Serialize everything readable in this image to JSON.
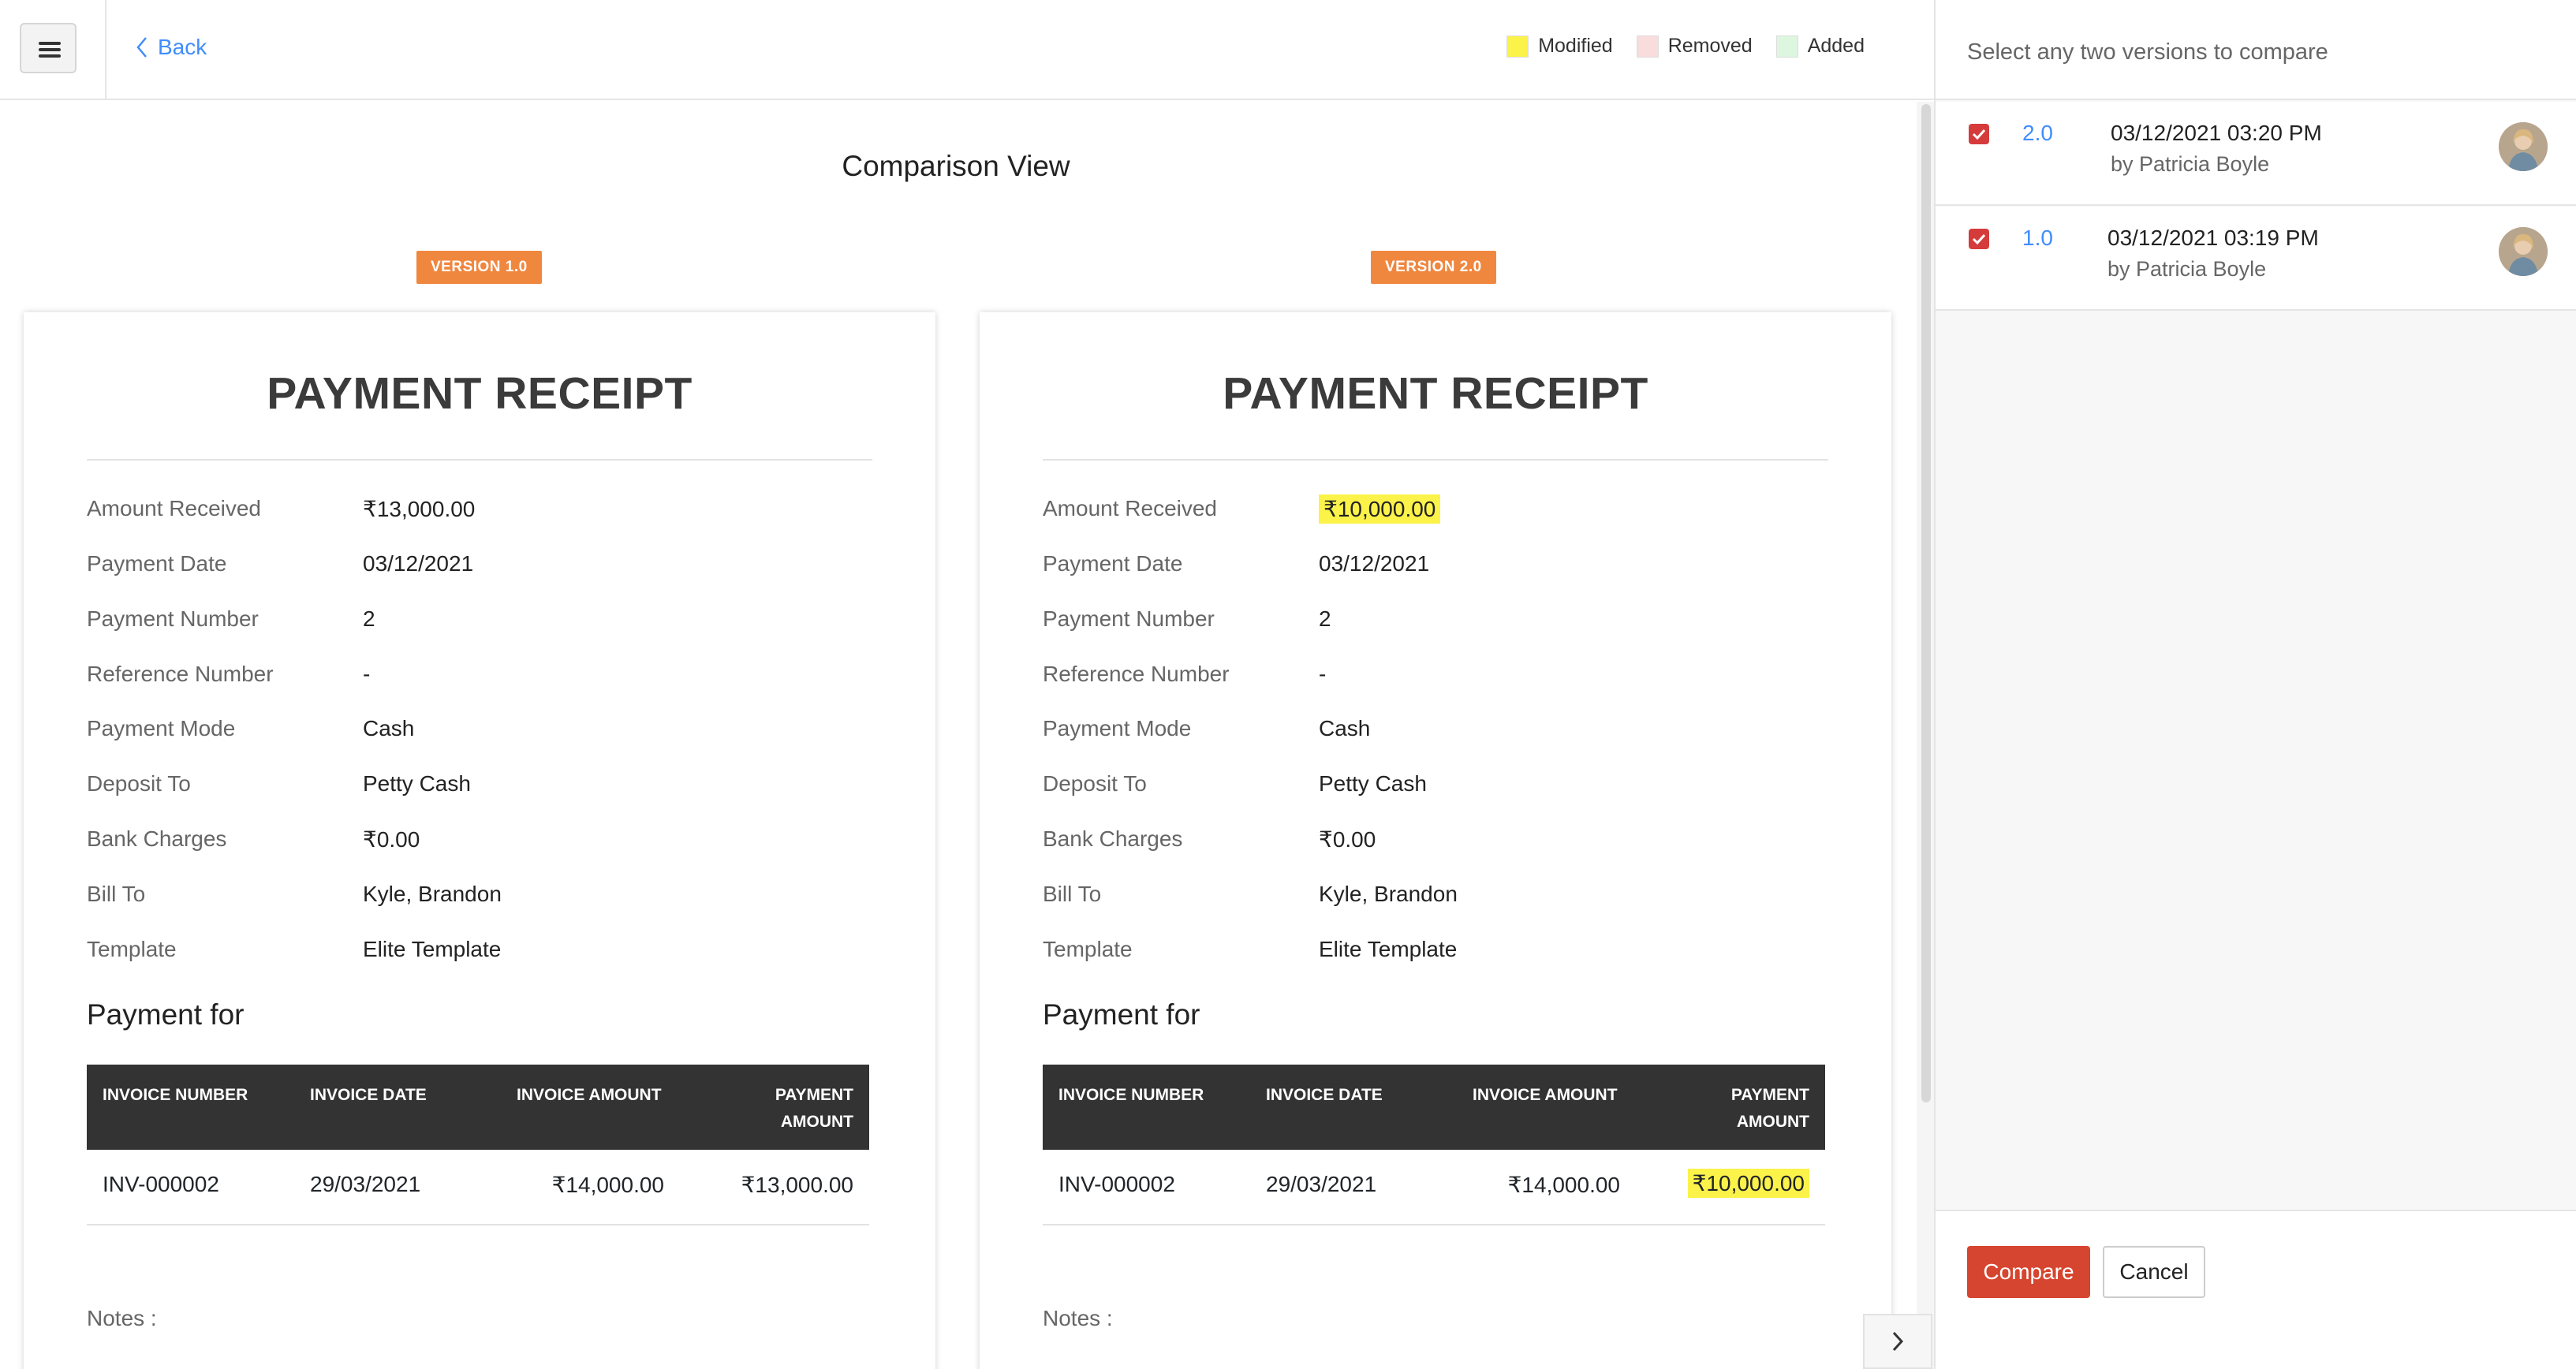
{
  "header": {
    "back_label": "Back",
    "legend": [
      {
        "label": "Modified",
        "color": "#fbf24a"
      },
      {
        "label": "Removed",
        "color": "#f9dcdc"
      },
      {
        "label": "Added",
        "color": "#dcf6df"
      }
    ]
  },
  "main": {
    "title": "Comparison View",
    "field_labels": [
      "Amount Received",
      "Payment Date",
      "Payment Number",
      "Reference Number",
      "Payment Mode",
      "Deposit To",
      "Bank Charges",
      "Bill To",
      "Template"
    ],
    "table_headers": [
      "INVOICE NUMBER",
      "INVOICE DATE",
      "INVOICE AMOUNT",
      "PAYMENT",
      "AMOUNT"
    ],
    "payment_for_label": "Payment for",
    "notes_label": "Notes :",
    "doc_title": "PAYMENT RECEIPT",
    "versions": [
      {
        "badge": "VERSION 1.0",
        "fields": [
          "₹13,000.00",
          "03/12/2021",
          "2",
          "-",
          "Cash",
          "Petty Cash",
          "₹0.00",
          "Kyle, Brandon",
          "Elite Template"
        ],
        "row": {
          "invoice_number": "INV-000002",
          "invoice_date": "29/03/2021",
          "invoice_amount": "₹14,000.00",
          "payment_amount": "₹13,000.00"
        }
      },
      {
        "badge": "VERSION 2.0",
        "fields": [
          "₹10,000.00",
          "03/12/2021",
          "2",
          "-",
          "Cash",
          "Petty Cash",
          "₹0.00",
          "Kyle, Brandon",
          "Elite Template"
        ],
        "row": {
          "invoice_number": "INV-000002",
          "invoice_date": "29/03/2021",
          "invoice_amount": "₹14,000.00",
          "payment_amount": "₹10,000.00"
        }
      }
    ]
  },
  "panel": {
    "header": "Select any two versions to compare",
    "items": [
      {
        "version": "2.0",
        "date": "03/12/2021 03:20 PM",
        "by": "by Patricia Boyle",
        "checked": true
      },
      {
        "version": "1.0",
        "date": "03/12/2021 03:19 PM",
        "by": "by Patricia Boyle",
        "checked": true
      }
    ],
    "compare_label": "Compare",
    "cancel_label": "Cancel"
  },
  "icons": {
    "menu": "hamburger-icon",
    "back": "chevron-left-icon",
    "toggle": "chevron-right-icon",
    "check": "check-icon"
  }
}
